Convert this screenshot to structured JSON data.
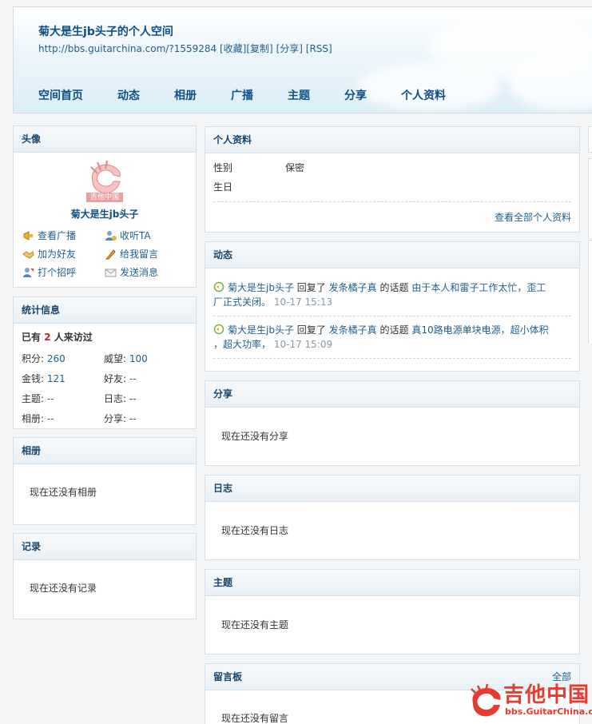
{
  "header": {
    "title": "菊大是生jb头子的个人空间",
    "url": "http://bbs.guitarchina.com/?1559284",
    "links": [
      "[收藏]",
      "[复制]",
      "[分享]",
      "[RSS]"
    ],
    "nav": [
      "空间首页",
      "动态",
      "相册",
      "广播",
      "主题",
      "分享",
      "个人资料"
    ]
  },
  "avatar_panel": {
    "title": "头像",
    "logo_text": "吉他中国",
    "username": "菊大是生jb头子",
    "actions": [
      {
        "label": "查看广播",
        "icon": "megaphone-icon"
      },
      {
        "label": "收听TA",
        "icon": "add-user-icon"
      },
      {
        "label": "加为好友",
        "icon": "handshake-icon"
      },
      {
        "label": "给我留言",
        "icon": "pencil-icon"
      },
      {
        "label": "打个招呼",
        "icon": "greet-icon"
      },
      {
        "label": "发送消息",
        "icon": "envelope-icon"
      }
    ]
  },
  "stats_panel": {
    "title": "统计信息",
    "visit_prefix": "已有",
    "visit_count": "2",
    "visit_suffix": "人来访过",
    "items": [
      {
        "label": "积分:",
        "value": "260"
      },
      {
        "label": "威望:",
        "value": "100"
      },
      {
        "label": "金钱:",
        "value": "121"
      },
      {
        "label": "好友:",
        "value": "--"
      },
      {
        "label": "主题:",
        "value": "--"
      },
      {
        "label": "日志:",
        "value": "--"
      },
      {
        "label": "相册:",
        "value": "--"
      },
      {
        "label": "分享:",
        "value": "--"
      }
    ]
  },
  "album_panel": {
    "title": "相册",
    "empty": "现在还没有相册"
  },
  "record_panel": {
    "title": "记录",
    "empty": "现在还没有记录"
  },
  "profile_panel": {
    "title": "个人资料",
    "rows": [
      {
        "key": "性别",
        "value": "保密"
      },
      {
        "key": "生日",
        "value": ""
      }
    ],
    "more": "查看全部个人资料"
  },
  "feed_panel": {
    "title": "动态",
    "items": [
      {
        "user": "菊大是生jb头子",
        "action": "回复了",
        "target_user": "发条橘子真",
        "mid": "的话题",
        "topic_line1": "由于本人和雷子工作太忙，歪工",
        "topic_line2": "厂正式关闭。",
        "time": "10-17 15:13"
      },
      {
        "user": "菊大是生jb头子",
        "action": "回复了",
        "target_user": "发条橘子真",
        "mid": "的话题",
        "topic_line1": "真10路电源单块电源，超小体积",
        "topic_line2": "，超大功率，",
        "time": "10-17 15:09"
      }
    ]
  },
  "share_panel": {
    "title": "分享",
    "empty": "现在还没有分享"
  },
  "blog_panel": {
    "title": "日志",
    "empty": "现在还没有日志"
  },
  "thread_panel": {
    "title": "主题",
    "empty": "现在还没有主题"
  },
  "guestbook_panel": {
    "title": "留言板",
    "more": "全部",
    "empty": "现在还没有留言"
  },
  "watermark": {
    "brand": "吉他中国",
    "site": "bbs.GuitarChina.com"
  },
  "colors": {
    "link": "#1f5f8a",
    "title": "#0f4f86",
    "accent_red": "#d02020"
  }
}
